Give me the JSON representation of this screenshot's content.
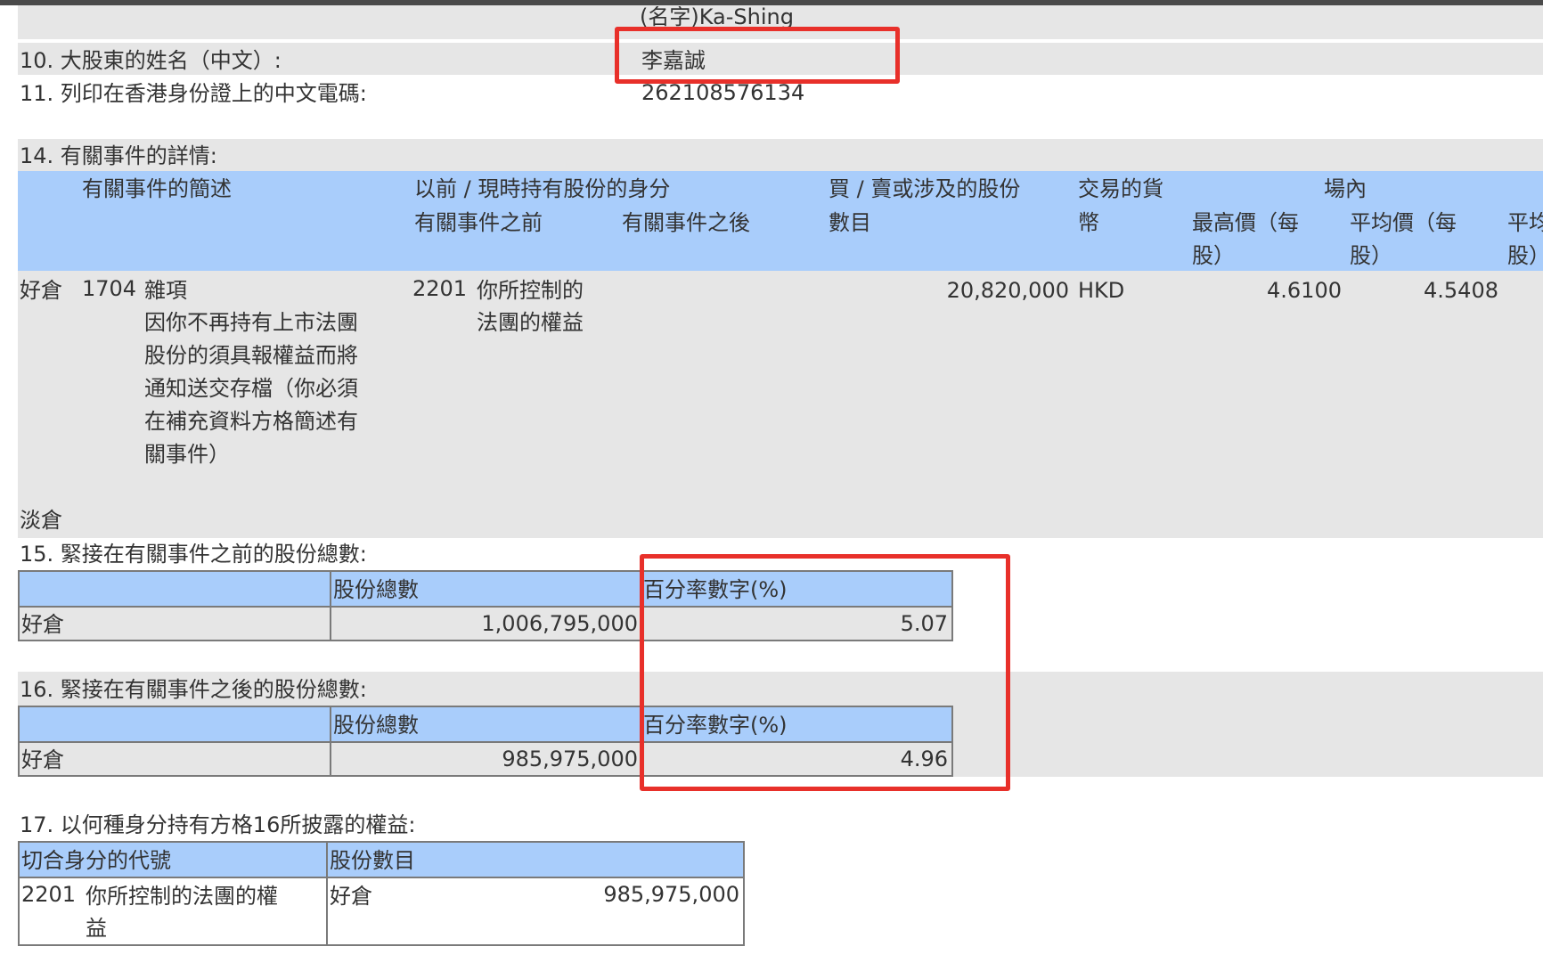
{
  "top_name_text": "(名字)Ka-Shing",
  "q10": {
    "label": "10. 大股東的姓名（中文）:",
    "value": "李嘉誠"
  },
  "q11": {
    "label": "11. 列印在香港身份證上的中文電碼:",
    "value": "262108576134"
  },
  "q14": {
    "label": "14. 有關事件的詳情:",
    "headers": {
      "event_desc": "有關事件的簡述",
      "capacity": "以前 / 現時持有股份的身分",
      "before": "有關事件之前",
      "after": "有關事件之後",
      "shares_line1": "買 / 賣或涉及的股份",
      "shares_line2": "數目",
      "currency_line1": "交易的貨",
      "currency_line2": "幣",
      "onexchange": "場內",
      "highest_line1": "最高價（每",
      "highest_line2": "股）",
      "average_line1": "平均價（每",
      "average_line2": "股）",
      "cut_line1": "平均",
      "cut_line2": "股）"
    },
    "row": {
      "position": "好倉",
      "event_code": "1704",
      "event_title": "雜項",
      "event_desc_lines": [
        "因你不再持有上市法團",
        "股份的須具報權益而將",
        "通知送交存檔（你必須",
        "在補充資料方格簡述有",
        "關事件）"
      ],
      "capacity_code": "2201",
      "capacity_lines": [
        "你所控制的",
        "法團的權益"
      ],
      "shares": "20,820,000",
      "currency": "HKD",
      "highest": "4.6100",
      "average": "4.5408"
    },
    "short_label": "淡倉"
  },
  "q15": {
    "label": "15. 緊接在有關事件之前的股份總數:",
    "col_shares": "股份總數",
    "col_pct": "百分率數字(%)",
    "row_label": "好倉",
    "shares": "1,006,795,000",
    "pct": "5.07"
  },
  "q16": {
    "label": "16. 緊接在有關事件之後的股份總數:",
    "col_shares": "股份總數",
    "col_pct": "百分率數字(%)",
    "row_label": "好倉",
    "shares": "985,975,000",
    "pct": "4.96"
  },
  "q17": {
    "label": "17. 以何種身分持有方格16所披露的權益:",
    "col_code": "切合身分的代號",
    "col_shares": "股份數目",
    "code": "2201",
    "code_desc_lines": [
      "你所控制的法團的權",
      "益"
    ],
    "position": "好倉",
    "shares": "985,975,000"
  },
  "colors": {
    "header_blue": "#a9cdfb",
    "row_grey": "#e6e6e6",
    "highlight_red": "#e8302a"
  }
}
